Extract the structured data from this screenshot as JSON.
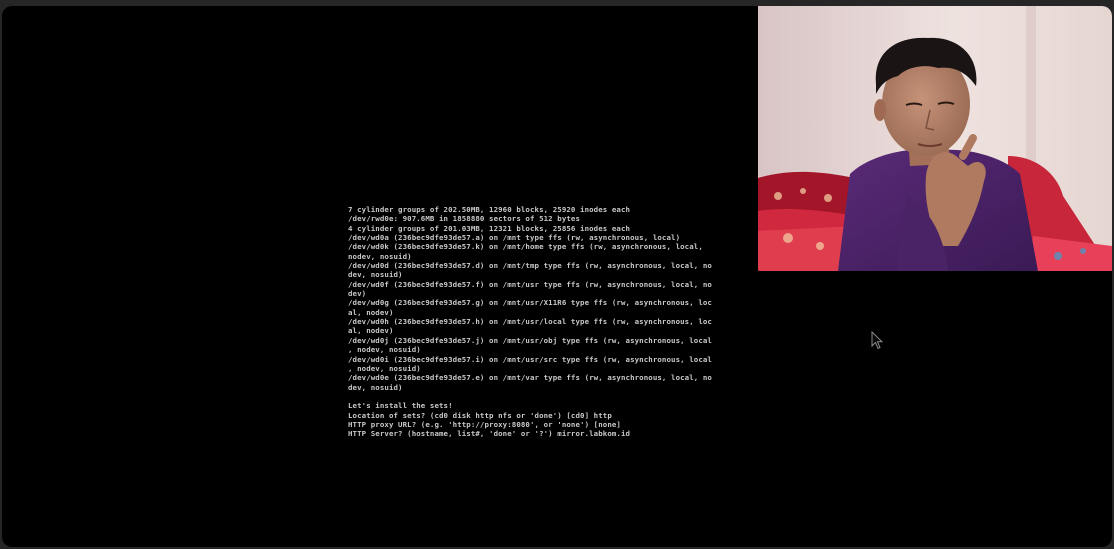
{
  "terminal": {
    "lines": [
      "7 cylinder groups of 202.50MB, 12960 blocks, 25920 inodes each",
      "/dev/rwd0e: 907.6MB in 1858880 sectors of 512 bytes",
      "4 cylinder groups of 201.03MB, 12321 blocks, 25856 inodes each",
      "/dev/wd0a (236bec9dfe93de57.a) on /mnt type ffs (rw, asynchronous, local)",
      "/dev/wd0k (236bec9dfe93de57.k) on /mnt/home type ffs (rw, asynchronous, local,",
      "nodev, nosuid)",
      "/dev/wd0d (236bec9dfe93de57.d) on /mnt/tmp type ffs (rw, asynchronous, local, no",
      "dev, nosuid)",
      "/dev/wd0f (236bec9dfe93de57.f) on /mnt/usr type ffs (rw, asynchronous, local, no",
      "dev)",
      "/dev/wd0g (236bec9dfe93de57.g) on /mnt/usr/X11R6 type ffs (rw, asynchronous, loc",
      "al, nodev)",
      "/dev/wd0h (236bec9dfe93de57.h) on /mnt/usr/local type ffs (rw, asynchronous, loc",
      "al, nodev)",
      "/dev/wd0j (236bec9dfe93de57.j) on /mnt/usr/obj type ffs (rw, asynchronous, local",
      ", nodev, nosuid)",
      "/dev/wd0i (236bec9dfe93de57.i) on /mnt/usr/src type ffs (rw, asynchronous, local",
      ", nodev, nosuid)",
      "/dev/wd0e (236bec9dfe93de57.e) on /mnt/var type ffs (rw, asynchronous, local, no",
      "dev, nosuid)",
      "",
      "Let's install the sets!",
      "Location of sets? (cd0 disk http nfs or 'done') [cd0] http",
      "HTTP proxy URL? (e.g. 'http://proxy:8080', or 'none') [none]",
      "HTTP Server? (hostname, list#, 'done' or '?') mirror.labkom.id"
    ]
  },
  "webcam": {
    "subject": "person-in-purple-shirt",
    "colors": {
      "wall": "#e8d8d4",
      "shirt": "#4a2366",
      "bedspread": "#c8263a",
      "hair": "#1a1414",
      "skin": "#b88468"
    }
  }
}
